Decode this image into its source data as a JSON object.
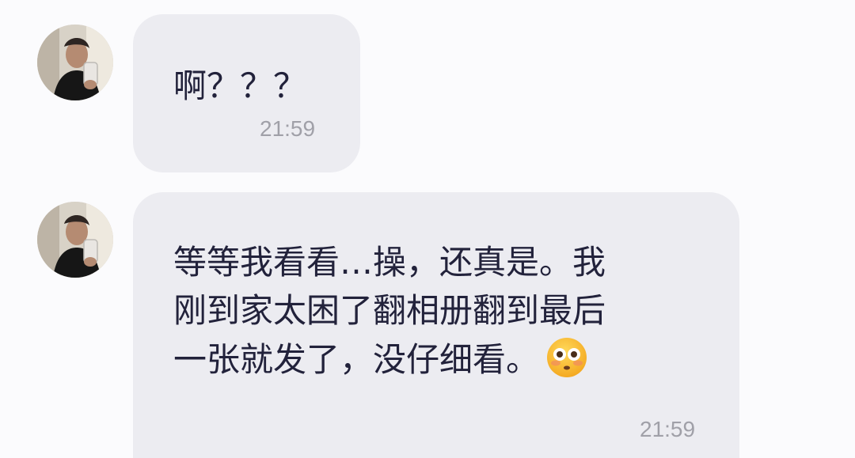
{
  "messages": [
    {
      "sender": "avatar",
      "text": "啊？？？",
      "time": "21:59"
    },
    {
      "sender": "avatar",
      "lines": [
        "等等我看看…操，还真是。我",
        "刚到家太困了翻相册翻到最后",
        "一张就发了，没仔细看。"
      ],
      "emoji": "flushed-face-emoji",
      "time": "21:59"
    }
  ],
  "colors": {
    "page_background": "#fbfbfd",
    "bubble_background": "#ececf1",
    "message_text": "#22223b",
    "timestamp_text": "#a0a0a8"
  }
}
